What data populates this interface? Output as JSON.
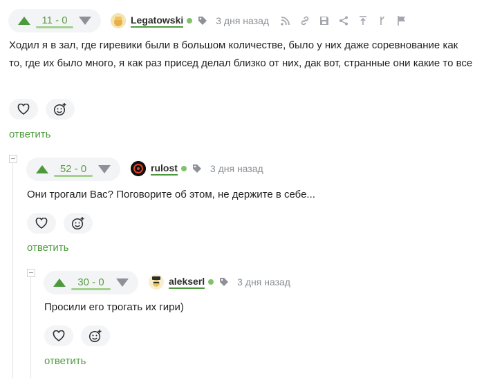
{
  "colors": {
    "accent": "#4d9a3d",
    "online": "#7fc26a",
    "muted": "#8a8e94"
  },
  "comments": [
    {
      "score": "11 - 0",
      "author": "Legatowski",
      "date": "3 дня назад",
      "text": "Ходил я в зал, где гиревики были в большом количестве, было у них даже соревнование как то, где их было много, я как раз присед делал близко от них, дак вот, странные они какие то все",
      "reply": "ответить",
      "icons": [
        "rss-icon",
        "link-icon",
        "save-icon",
        "share-icon",
        "branch-up-icon",
        "branch-icon",
        "flag-icon"
      ]
    },
    {
      "score": "52 - 0",
      "author": "rulost",
      "date": "3 дня назад",
      "text": "Они трогали Вас? Поговорите об этом, не держите в себе...",
      "reply": "ответить"
    },
    {
      "score": "30 - 0",
      "author": "alekserl",
      "date": "3 дня назад",
      "text": "Просили его трогать их гири)",
      "reply": "ответить"
    }
  ]
}
